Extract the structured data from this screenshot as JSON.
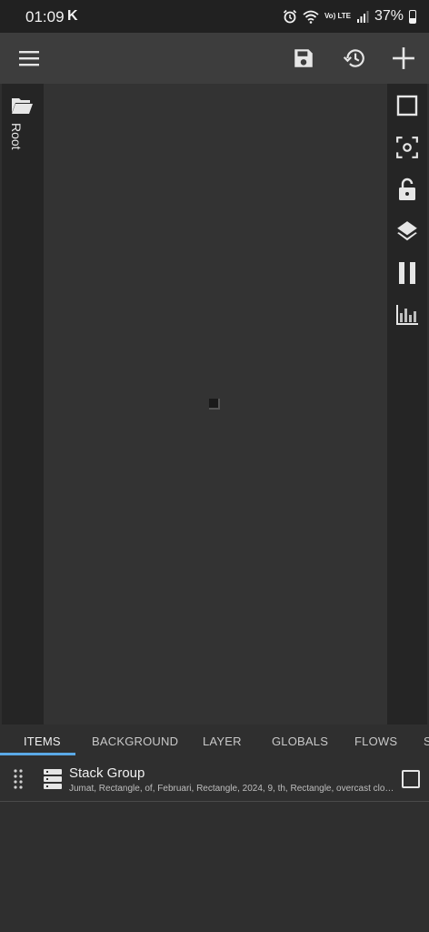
{
  "status_bar": {
    "time": "01:09",
    "app_glyph": "K",
    "network_label": "Vo) LTE",
    "battery_percent": "37%",
    "icons": [
      "alarm-icon",
      "wifi-icon",
      "signal-icon",
      "battery-icon"
    ]
  },
  "toolbar": {
    "icons": [
      "menu-icon",
      "save-icon",
      "history-icon",
      "add-icon"
    ]
  },
  "left_panel": {
    "root_label": "Root",
    "icon": "folder-open-icon"
  },
  "right_panel": {
    "icons": [
      "square-outline-icon",
      "center-focus-icon",
      "lock-open-icon",
      "layers-icon",
      "pause-icon",
      "equalizer-icon"
    ]
  },
  "tabs": [
    {
      "label": "ITEMS",
      "active": true
    },
    {
      "label": "BACKGROUND",
      "active": false
    },
    {
      "label": "LAYER",
      "active": false
    },
    {
      "label": "GLOBALS",
      "active": false
    },
    {
      "label": "FLOWS",
      "active": false
    },
    {
      "label": "S",
      "active": false
    }
  ],
  "items": [
    {
      "title": "Stack Group",
      "subtitle": "Jumat, Rectangle, of, Februari, Rectangle, 2024, 9, th, Rectangle, overcast cloud..",
      "checked": false
    }
  ],
  "colors": {
    "accent": "#5aa9e6",
    "toolbar": "#3d3d3d",
    "canvas": "#333333",
    "side_panel": "#252525"
  }
}
